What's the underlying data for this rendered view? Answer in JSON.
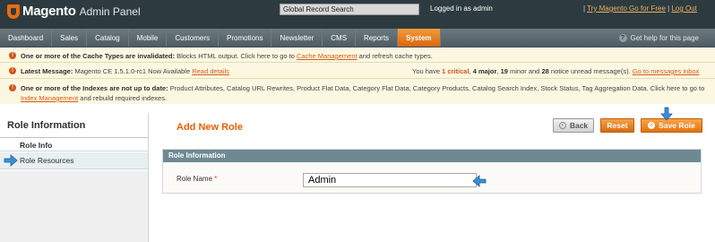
{
  "header": {
    "brand": "Magento",
    "brand_sub": "Admin Panel",
    "search_value": "Global Record Search",
    "logged_in": "Logged in as admin",
    "link_separator1": "|",
    "try_link": "Try Magento Go for Free",
    "link_separator2": "|",
    "logout_link": "Log Out"
  },
  "nav": {
    "items": [
      "Dashboard",
      "Sales",
      "Catalog",
      "Mobile",
      "Customers",
      "Promotions",
      "Newsletter",
      "CMS",
      "Reports",
      "System"
    ],
    "active": "System",
    "help": "Get help for this page"
  },
  "notices": {
    "cache_bold": "One or more of the Cache Types are invalidated:",
    "cache_text": " Blocks HTML output. Click here to go to ",
    "cache_link": "Cache Management",
    "cache_tail": " and refresh cache types.",
    "latest_bold": "Latest Message:",
    "latest_text": " Magento CE 1.5.1.0-rc1 Now Available ",
    "latest_link": "Read details",
    "msg_prefix": "You have ",
    "msg_critical": "1 critical",
    "msg_sep1": ", ",
    "msg_major": "4 major",
    "msg_sep2": ", ",
    "msg_minor": "19",
    "msg_minor_label": " minor and ",
    "msg_notice": "28",
    "msg_tail": " notice unread message(s). ",
    "msg_link": "Go to messages inbox",
    "index_bold": "One or more of the Indexes are not up to date:",
    "index_text": " Product Attributes, Catalog URL Rewrites, Product Flat Data, Category Flat Data, Category Products, Catalog Search Index, Stock Status, Tag Aggregation Data. Click here to go to ",
    "index_link": "Index Management",
    "index_tail": " and rebuild required indexes."
  },
  "sidebar": {
    "title": "Role Information",
    "tabs": [
      "Role Info",
      "Role Resources"
    ]
  },
  "main": {
    "title": "Add New Role",
    "back_label": "Back",
    "reset_label": "Reset",
    "save_label": "Save Role",
    "fieldset_title": "Role Information",
    "role_name_label": "Role Name",
    "required_mark": "*",
    "role_name_value": "Admin"
  },
  "colors": {
    "accent": "#eb5e00",
    "header_bg": "#2d3b40",
    "notice_bg": "#fbf7e0",
    "fieldset_head": "#6f8992",
    "arrow": "#3a8fd8"
  }
}
